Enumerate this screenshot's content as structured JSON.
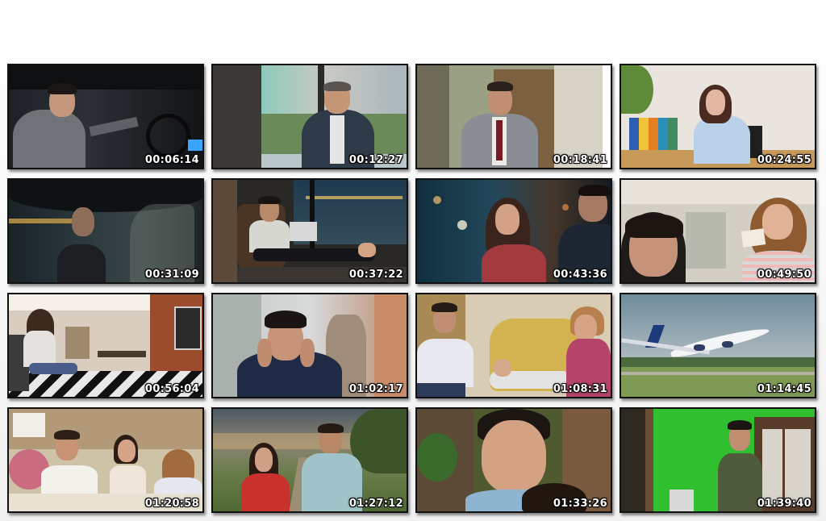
{
  "thumbnails": [
    {
      "timestamp": "00:06:14",
      "scene": "man in grey suit driving car at night with earpiece"
    },
    {
      "timestamp": "00:12:27",
      "scene": "smiling man in suit by office window with city view"
    },
    {
      "timestamp": "00:18:41",
      "scene": "man in grey suit and red tie standing in office"
    },
    {
      "timestamp": "00:24:55",
      "scene": "woman seated at desk with colorful binders"
    },
    {
      "timestamp": "00:31:09",
      "scene": "two men in car at night"
    },
    {
      "timestamp": "00:37:22",
      "scene": "boy with laptop, feet on desk by window"
    },
    {
      "timestamp": "00:43:36",
      "scene": "woman in red floral dress talking to man at night"
    },
    {
      "timestamp": "00:49:50",
      "scene": "curly-haired woman holding card facing man"
    },
    {
      "timestamp": "00:56:04",
      "scene": "girl sitting on sofa in modern living room"
    },
    {
      "timestamp": "01:02:17",
      "scene": "stressed man in suit with hands on face"
    },
    {
      "timestamp": "01:08:31",
      "scene": "man and woman caring for girl on sofa"
    },
    {
      "timestamp": "01:14:45",
      "scene": "white airliner landing on runway"
    },
    {
      "timestamp": "01:20:58",
      "scene": "family at breakfast table with flowers"
    },
    {
      "timestamp": "01:27:12",
      "scene": "woman in red and man standing on country road"
    },
    {
      "timestamp": "01:33:26",
      "scene": "smiling man close-up near tree"
    },
    {
      "timestamp": "01:39:40",
      "scene": "man standing in green room"
    }
  ]
}
